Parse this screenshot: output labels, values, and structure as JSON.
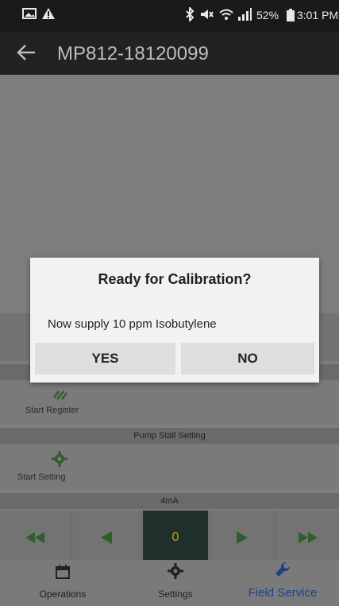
{
  "status_bar": {
    "battery": "52%",
    "time": "3:01 PM",
    "icons": [
      "image-icon",
      "alert-icon",
      "bluetooth-icon",
      "mute-icon",
      "wifi-icon",
      "signal-icon",
      "battery-icon"
    ]
  },
  "app_bar": {
    "title": "MP812-18120099"
  },
  "sections": {
    "start_register_label": "Start Register",
    "pump_stall_setting": "Pump Stall Setting",
    "start_setting_label": "Start Setting",
    "ma_header": "4mA"
  },
  "controls": {
    "value": "0"
  },
  "bottom_nav": {
    "operations": "Operations",
    "settings": "Settings",
    "field_service": "Field Service"
  },
  "dialog": {
    "title": "Ready for Calibration?",
    "message": "Now supply 10 ppm Isobutylene",
    "yes": "YES",
    "no": "NO"
  },
  "colors": {
    "accent": "#1f3f88",
    "green_controls": "#2e5e2e",
    "value_yellow": "#c8a000",
    "value_bg": "#1f2f2b"
  }
}
